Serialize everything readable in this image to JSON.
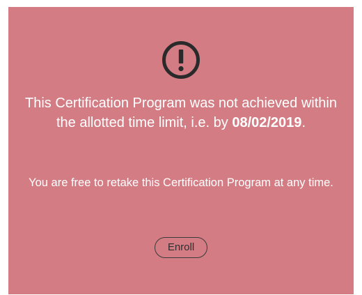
{
  "alert": {
    "icon": "exclamation-circle-icon",
    "background_color": "#d47c84",
    "message_before": "This Certification Program was not achieved within the allotted time limit, i.e. by ",
    "deadline_date": "08/02/2019",
    "message_after": ".",
    "note": "You are free to retake this Certification Program at any time.",
    "enroll_label": "Enroll"
  }
}
